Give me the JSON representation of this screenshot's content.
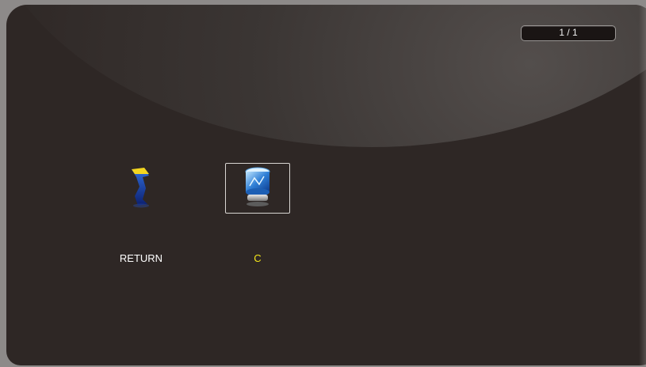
{
  "pager": {
    "text": "1 / 1"
  },
  "items": [
    {
      "label": "RETURN",
      "icon": "return-arrow-icon",
      "selected": false,
      "label_color": "#ffffff"
    },
    {
      "label": "C",
      "icon": "drive-icon",
      "selected": true,
      "label_color": "#f4e61a"
    }
  ],
  "colors": {
    "background": "#2e2725",
    "frame": "#8d8a89",
    "selected_label": "#f4e61a"
  }
}
